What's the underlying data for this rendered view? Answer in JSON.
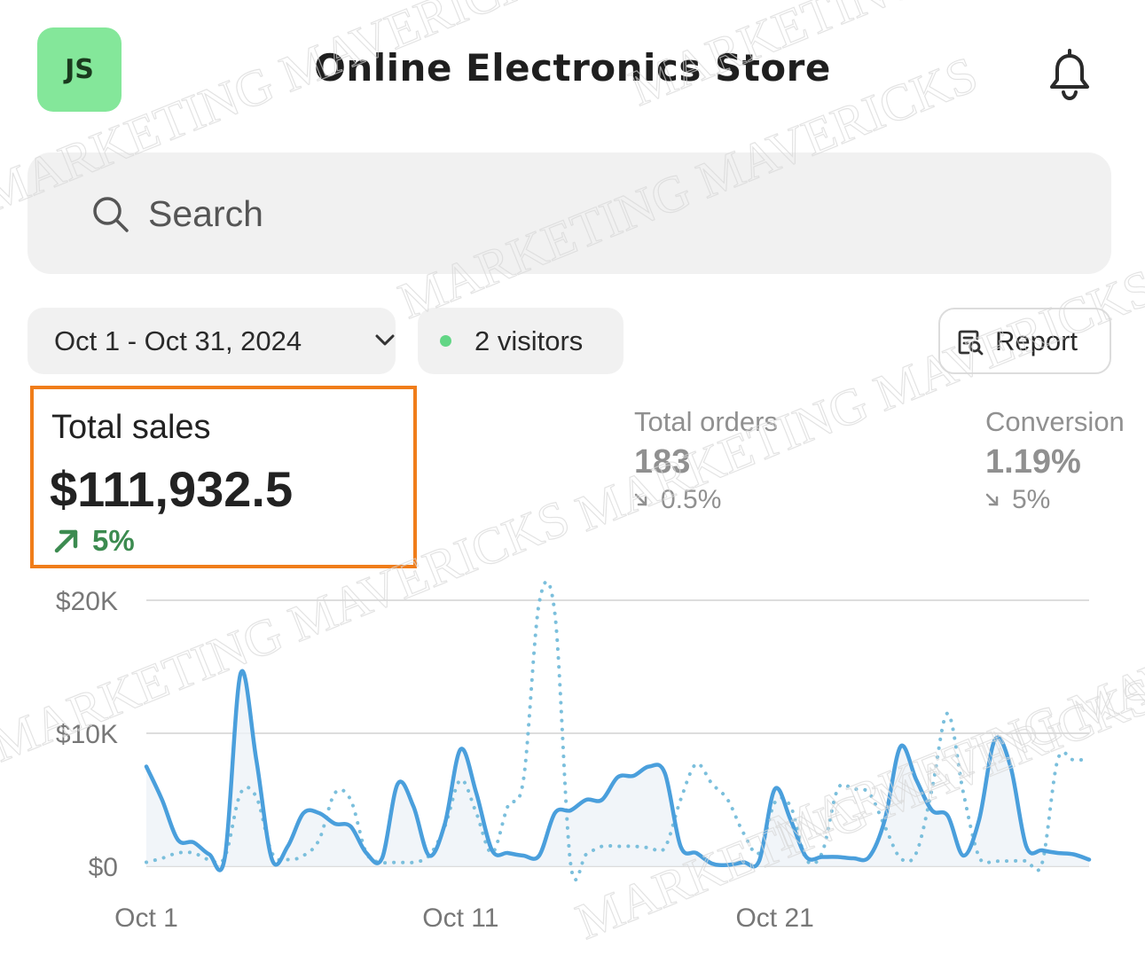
{
  "header": {
    "avatar_initials": "JS",
    "avatar_color": "#84e79a",
    "title": "Online Electronics Store",
    "bell_icon": "bell-icon"
  },
  "search": {
    "placeholder": "Search",
    "icon": "search-icon"
  },
  "filters": {
    "date_range": "Oct 1 - Oct 31, 2024",
    "visitors": "2 visitors",
    "visitors_dot_color": "#62d685",
    "report_label": "Report"
  },
  "metrics": {
    "total_sales": {
      "label": "Total sales",
      "value": "$111,932.5",
      "change": "5%",
      "direction": "up",
      "color": "#3c8b50",
      "highlight_color": "#f07d1a"
    },
    "total_orders": {
      "label": "Total orders",
      "value": "183",
      "change": "0.5%",
      "direction": "down"
    },
    "conversion": {
      "label": "Conversion",
      "value": "1.19%",
      "change": "5%",
      "direction": "down"
    }
  },
  "watermark": "MARKETING MAVERICKS",
  "chart_data": {
    "type": "line",
    "y_ticks": [
      "$0",
      "$10K",
      "$20K"
    ],
    "x_ticks": [
      "Oct 1",
      "Oct 11",
      "Oct 21"
    ],
    "ylim": [
      0,
      20000
    ],
    "grid": true,
    "series": [
      {
        "style": "solid",
        "color": "#4a9fdc",
        "x": [
          1,
          1.5,
          2,
          2.5,
          3,
          3.5,
          4,
          4.5,
          5,
          5.5,
          6,
          6.5,
          7,
          7.5,
          8,
          8.5,
          9,
          9.5,
          10,
          10.5,
          11,
          11.5,
          12,
          12.5,
          13,
          13.5,
          14,
          14.5,
          15,
          15.5,
          16,
          16.5,
          17,
          17.5,
          18,
          18.5,
          19,
          19.5,
          20,
          20.5,
          21,
          21.5,
          22,
          22.5,
          23,
          23.5,
          24,
          24.5,
          25,
          25.5,
          26,
          26.5,
          27,
          27.5,
          28,
          28.5,
          29,
          29.5,
          30,
          30.5,
          31
        ],
        "y": [
          7500,
          5000,
          2000,
          1800,
          900,
          700,
          14500,
          8000,
          500,
          1500,
          4000,
          4000,
          3200,
          3000,
          1000,
          600,
          6200,
          4500,
          800,
          3200,
          8800,
          5500,
          1200,
          1000,
          800,
          800,
          4000,
          4200,
          5000,
          5000,
          6700,
          6800,
          7500,
          7000,
          1500,
          1000,
          200,
          100,
          300,
          400,
          5800,
          3500,
          700,
          700,
          700,
          600,
          700,
          3500,
          9000,
          6500,
          4200,
          3800,
          800,
          3500,
          9500,
          7500,
          1500,
          1200,
          1000,
          900,
          500
        ]
      },
      {
        "style": "dotted",
        "color": "#7bbfdc",
        "x": [
          1,
          1.5,
          2,
          2.5,
          3,
          3.5,
          4,
          4.5,
          5,
          5.5,
          6,
          6.5,
          7,
          7.5,
          8,
          8.5,
          9,
          9.5,
          10,
          10.5,
          11,
          11.5,
          12,
          12.5,
          13,
          13.5,
          14,
          14.5,
          15,
          15.5,
          16,
          16.5,
          17,
          17.5,
          18,
          18.5,
          19,
          19.5,
          20,
          20.5,
          21,
          21.5,
          22,
          22.5,
          23,
          23.5,
          24,
          24.5,
          25,
          25.5,
          26,
          26.5,
          27,
          27.5,
          28,
          28.5,
          29,
          29.5,
          30,
          30.5,
          31
        ],
        "y": [
          300,
          600,
          1000,
          1000,
          500,
          700,
          5500,
          5200,
          1000,
          500,
          800,
          2000,
          5500,
          5000,
          1000,
          300,
          300,
          300,
          800,
          3000,
          6500,
          4000,
          1000,
          4500,
          6500,
          19800,
          19000,
          200,
          900,
          1500,
          1500,
          1500,
          1400,
          1400,
          5000,
          7700,
          6200,
          5000,
          2500,
          1000,
          4800,
          4500,
          500,
          1000,
          5800,
          5800,
          5500,
          3000,
          600,
          1000,
          5800,
          11500,
          5500,
          700,
          400,
          400,
          400,
          200,
          8000,
          8000,
          8000
        ]
      }
    ]
  }
}
